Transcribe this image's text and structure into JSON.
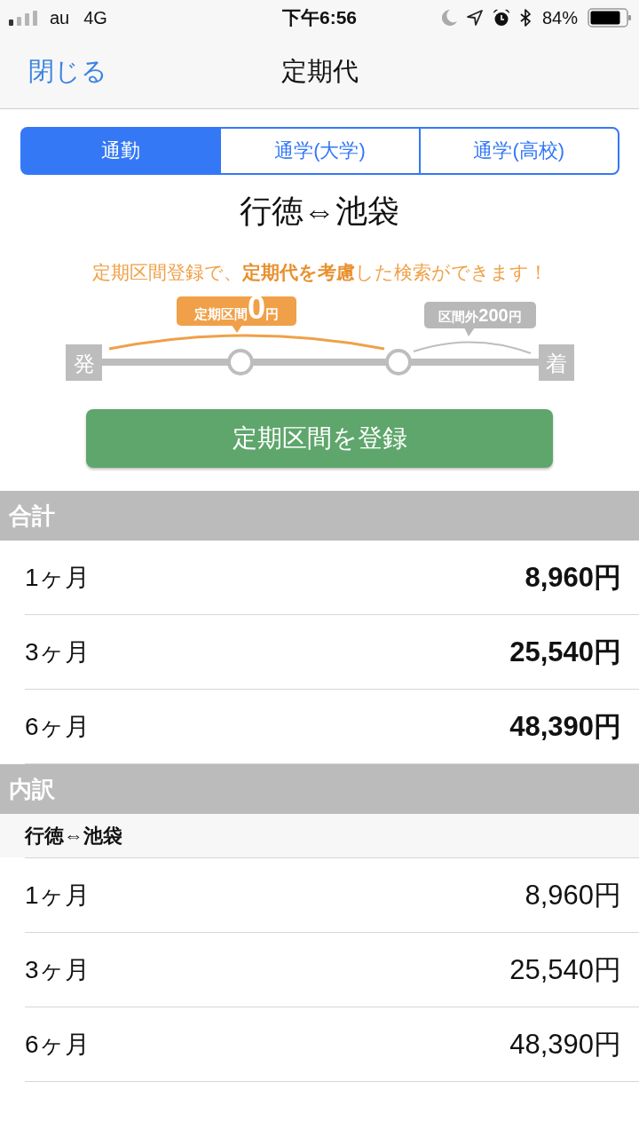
{
  "status_bar": {
    "carrier": "au",
    "network": "4G",
    "time": "下午6:56",
    "battery": "84%"
  },
  "nav": {
    "back": "閉じる",
    "title": "定期代"
  },
  "tabs": [
    {
      "label": "通勤",
      "selected": true
    },
    {
      "label": "通学(大学)",
      "selected": false
    },
    {
      "label": "通学(高校)",
      "selected": false
    }
  ],
  "route_title": "行徳⇔池袋",
  "notice": "定期区間登録で、**定期代を考慮**した検索ができます！",
  "diagram": {
    "start_label": "発",
    "end_label": "着",
    "pass_badge": {
      "label": "定期区間",
      "amount": "0",
      "unit": "円"
    },
    "outside_badge": {
      "label": "区間外",
      "amount": "200",
      "unit": "円"
    }
  },
  "register_button": "定期区間を登録",
  "sections": [
    {
      "title": "合計",
      "kind": "total",
      "rows": [
        {
          "period": "1ヶ月",
          "fare": "8,960円"
        },
        {
          "period": "3ヶ月",
          "fare": "25,540円"
        },
        {
          "period": "6ヶ月",
          "fare": "48,390円"
        }
      ]
    },
    {
      "title": "内訳",
      "kind": "breakdown",
      "subheading": "行徳⇔池袋",
      "rows": [
        {
          "period": "1ヶ月",
          "fare": "8,960円"
        },
        {
          "period": "3ヶ月",
          "fare": "25,540円"
        },
        {
          "period": "6ヶ月",
          "fare": "48,390円"
        }
      ]
    }
  ]
}
